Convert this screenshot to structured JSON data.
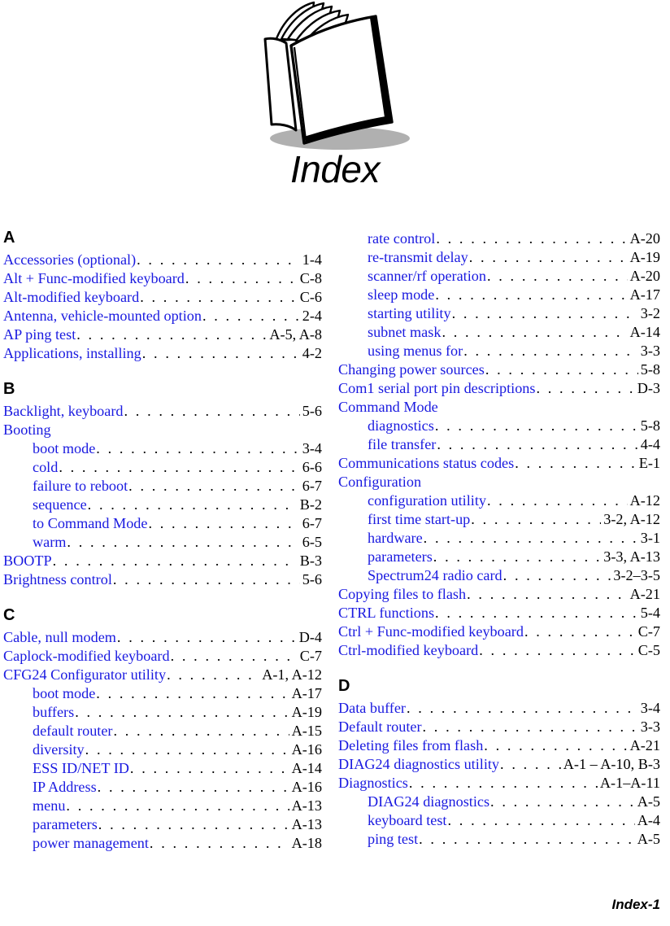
{
  "header": {
    "title": "Index",
    "illustration_icon": "open-book-icon"
  },
  "footer": {
    "page_label": "Index-1"
  },
  "colors": {
    "entry_text": "#1a1aE0",
    "page_number": "#000000",
    "section_letter": "#000000",
    "shadow": "#b0b0b0"
  },
  "columns": [
    {
      "name": "left",
      "sections": [
        {
          "letter": "A",
          "entries": [
            {
              "label": "Accessories (optional)",
              "page": "1-4",
              "sub": false
            },
            {
              "label": "Alt + Func-modified keyboard",
              "page": "C-8",
              "sub": false
            },
            {
              "label": "Alt-modified keyboard",
              "page": "C-6",
              "sub": false
            },
            {
              "label": "Antenna, vehicle-mounted option",
              "page": "2-4",
              "sub": false
            },
            {
              "label": "AP ping test",
              "page": "A-5, A-8",
              "sub": false
            },
            {
              "label": "Applications, installing",
              "page": "4-2",
              "sub": false
            }
          ]
        },
        {
          "letter": "B",
          "entries": [
            {
              "label": "Backlight, keyboard",
              "page": "5-6",
              "sub": false
            },
            {
              "label": "Booting",
              "page": "",
              "sub": false
            },
            {
              "label": "boot mode",
              "page": "3-4",
              "sub": true
            },
            {
              "label": "cold",
              "page": "6-6",
              "sub": true
            },
            {
              "label": "failure to reboot",
              "page": "6-7",
              "sub": true
            },
            {
              "label": "sequence",
              "page": "B-2",
              "sub": true
            },
            {
              "label": "to Command Mode",
              "page": "6-7",
              "sub": true
            },
            {
              "label": "warm",
              "page": "6-5",
              "sub": true
            },
            {
              "label": "BOOTP",
              "page": "B-3",
              "sub": false
            },
            {
              "label": "Brightness control",
              "page": "5-6",
              "sub": false
            }
          ]
        },
        {
          "letter": "C",
          "entries": [
            {
              "label": "Cable, null modem",
              "page": "D-4",
              "sub": false
            },
            {
              "label": "Caplock-modified keyboard",
              "page": "C-7",
              "sub": false
            },
            {
              "label": "CFG24 Configurator utility",
              "page": "A-1, A-12",
              "sub": false
            },
            {
              "label": "boot mode",
              "page": "A-17",
              "sub": true
            },
            {
              "label": "buffers",
              "page": "A-19",
              "sub": true
            },
            {
              "label": "default router",
              "page": "A-15",
              "sub": true
            },
            {
              "label": "diversity",
              "page": "A-16",
              "sub": true
            },
            {
              "label": "ESS ID/NET ID",
              "page": "A-14",
              "sub": true
            },
            {
              "label": "IP Address",
              "page": "A-16",
              "sub": true
            },
            {
              "label": "menu",
              "page": "A-13",
              "sub": true
            },
            {
              "label": "parameters",
              "page": "A-13",
              "sub": true
            },
            {
              "label": "power management",
              "page": "A-18",
              "sub": true
            }
          ]
        }
      ]
    },
    {
      "name": "right",
      "sections": [
        {
          "letter": "",
          "entries": [
            {
              "label": "rate control",
              "page": "A-20",
              "sub": true
            },
            {
              "label": "re-transmit delay",
              "page": "A-19",
              "sub": true
            },
            {
              "label": "scanner/rf operation",
              "page": "A-20",
              "sub": true
            },
            {
              "label": "sleep mode",
              "page": "A-17",
              "sub": true
            },
            {
              "label": "starting utility",
              "page": "3-2",
              "sub": true
            },
            {
              "label": "subnet mask",
              "page": "A-14",
              "sub": true
            },
            {
              "label": "using menus for",
              "page": "3-3",
              "sub": true
            },
            {
              "label": "Changing power sources",
              "page": "5-8",
              "sub": false
            },
            {
              "label": "Com1 serial port pin descriptions",
              "page": "D-3",
              "sub": false
            },
            {
              "label": "Command Mode",
              "page": "",
              "sub": false
            },
            {
              "label": "diagnostics",
              "page": "5-8",
              "sub": true
            },
            {
              "label": "file transfer",
              "page": "4-4",
              "sub": true
            },
            {
              "label": "Communications status codes",
              "page": "E-1",
              "sub": false
            },
            {
              "label": "Configuration",
              "page": "",
              "sub": false
            },
            {
              "label": "configuration utility",
              "page": "A-12",
              "sub": true
            },
            {
              "label": "first time start-up",
              "page": "3-2, A-12",
              "sub": true
            },
            {
              "label": "hardware",
              "page": "3-1",
              "sub": true
            },
            {
              "label": "parameters",
              "page": "3-3, A-13",
              "sub": true
            },
            {
              "label": "Spectrum24 radio card",
              "page": "3-2–3-5",
              "sub": true
            },
            {
              "label": "Copying files to flash",
              "page": "A-21",
              "sub": false
            },
            {
              "label": "CTRL functions",
              "page": "5-4",
              "sub": false
            },
            {
              "label": "Ctrl + Func-modified keyboard",
              "page": "C-7",
              "sub": false
            },
            {
              "label": "Ctrl-modified keyboard",
              "page": "C-5",
              "sub": false
            }
          ]
        },
        {
          "letter": "D",
          "entries": [
            {
              "label": "Data buffer",
              "page": "3-4",
              "sub": false
            },
            {
              "label": "Default router",
              "page": "3-3",
              "sub": false
            },
            {
              "label": "Deleting files from flash",
              "page": "A-21",
              "sub": false
            },
            {
              "label": "DIAG24 diagnostics utility",
              "page": "A-1 – A-10, B-3",
              "sub": false
            },
            {
              "label": "Diagnostics",
              "page": "A-1–A-11",
              "sub": false
            },
            {
              "label": "DIAG24 diagnostics",
              "page": "A-5",
              "sub": true
            },
            {
              "label": "keyboard test",
              "page": "A-4",
              "sub": true
            },
            {
              "label": "ping test",
              "page": "A-5",
              "sub": true
            }
          ]
        }
      ]
    }
  ]
}
